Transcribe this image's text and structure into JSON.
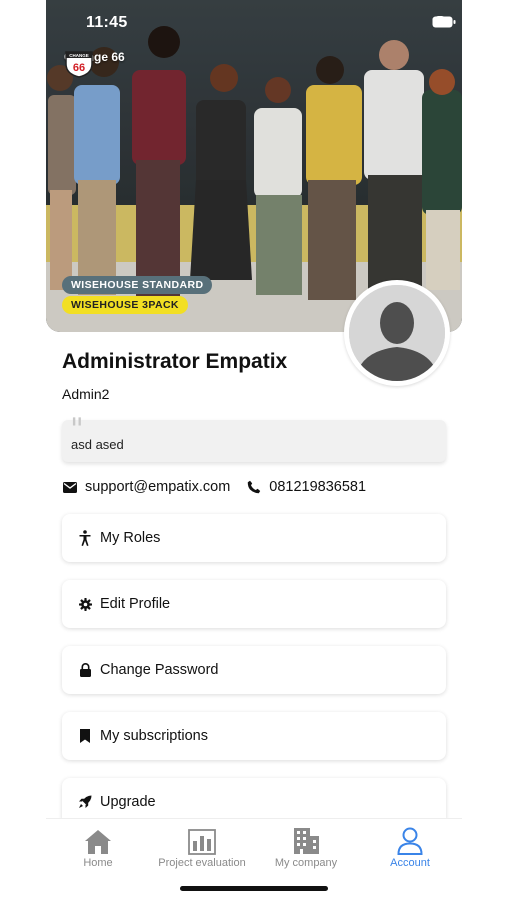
{
  "status_bar": {
    "time": "11:45"
  },
  "brand": {
    "name": "Change 66",
    "logo_text": "66",
    "logo_top": "CHANGE"
  },
  "badges": {
    "plan": "WISEHOUSE STANDARD",
    "pack": "WISEHOUSE 3PACK"
  },
  "profile": {
    "name": "Administrator Empatix",
    "username": "Admin2",
    "bio": "asd ased",
    "email": "support@empatix.com",
    "phone": "081219836581"
  },
  "menu": {
    "roles": "My Roles",
    "edit_profile": "Edit Profile",
    "change_password": "Change Password",
    "subscriptions": "My subscriptions",
    "upgrade": "Upgrade"
  },
  "tabs": {
    "home": "Home",
    "project_evaluation": "Project evaluation",
    "my_company": "My company",
    "account": "Account"
  },
  "colors": {
    "accent": "#3a84e8",
    "badge_standard": "#58707a",
    "badge_pack": "#f2df23"
  }
}
